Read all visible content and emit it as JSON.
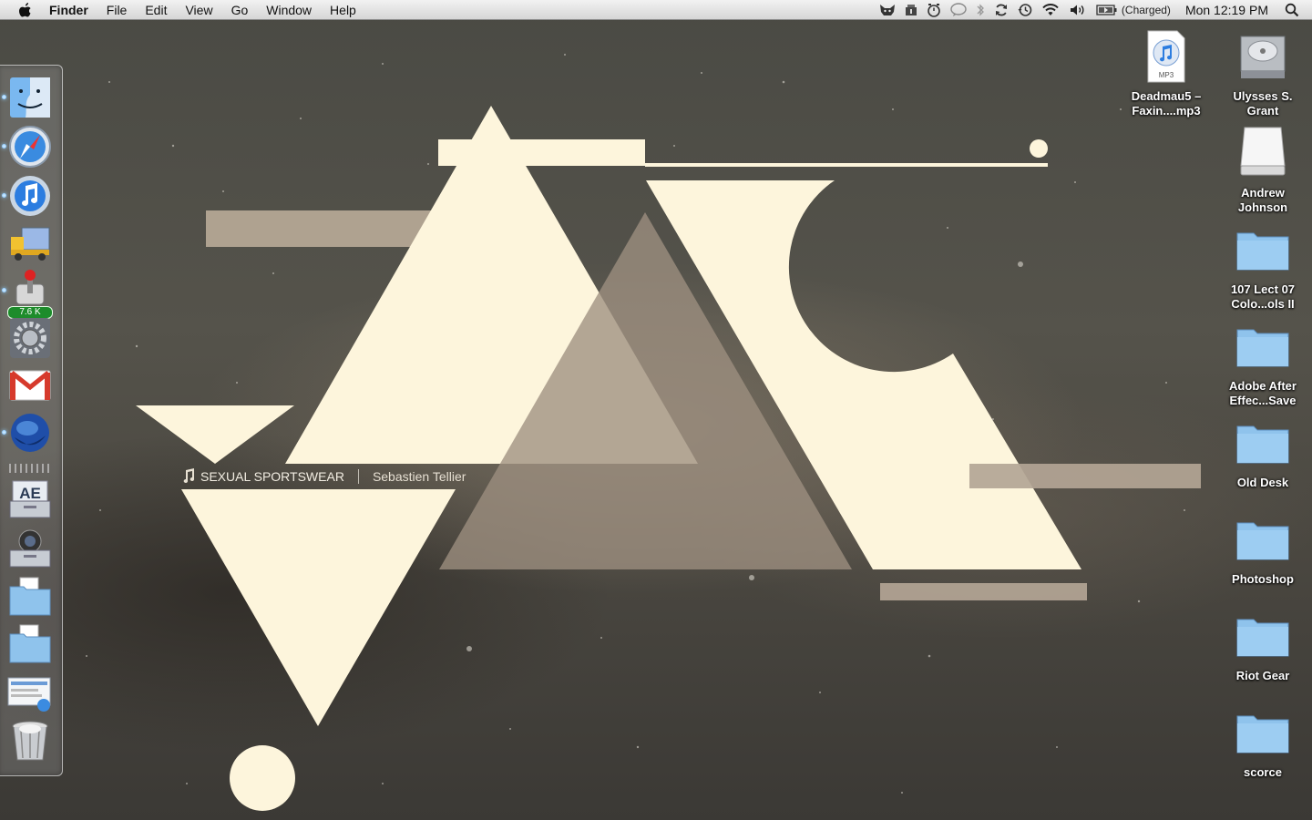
{
  "menubar": {
    "apple_icon": "apple-icon",
    "app_name": "Finder",
    "menus": [
      "File",
      "Edit",
      "View",
      "Go",
      "Window",
      "Help"
    ],
    "status": {
      "battery_text": "(Charged)",
      "clock": "Mon 12:19 PM"
    }
  },
  "now_playing": {
    "track": "SEXUAL SPORTSWEAR",
    "artist": "Sebastien Tellier"
  },
  "dock": {
    "badges": {
      "transmission": "7.6 K"
    },
    "items": [
      "Finder",
      "Safari",
      "iTunes",
      "Transmit",
      "Transmission",
      "System Preferences",
      "Gmail",
      "Firefox",
      "After Effects Folder",
      "Camera Folder",
      "Folder",
      "Folder",
      "Documents Stack",
      "Trash"
    ]
  },
  "desktop_icons": [
    {
      "label_line1": "Deadmau5 –",
      "label_line2": "Faxin....mp3",
      "type": "mp3",
      "file_badge": "MP3"
    },
    {
      "label_line1": "Ulysses S.",
      "label_line2": "Grant",
      "type": "hard-drive"
    },
    {
      "label_line1": "Andrew",
      "label_line2": "Johnson",
      "type": "external-drive"
    },
    {
      "label_line1": "107 Lect 07",
      "label_line2": "Colo...ols II",
      "type": "folder"
    },
    {
      "label_line1": "Adobe After",
      "label_line2": "Effec...Save",
      "type": "folder"
    },
    {
      "label_line1": "Old Desk",
      "label_line2": "",
      "type": "folder"
    },
    {
      "label_line1": "Photoshop",
      "label_line2": "",
      "type": "folder"
    },
    {
      "label_line1": "Riot Gear",
      "label_line2": "",
      "type": "folder"
    },
    {
      "label_line1": "scorce",
      "label_line2": "",
      "type": "folder"
    }
  ],
  "colors": {
    "cream": "#fdf5dc",
    "taupe": "#b3a595",
    "folder_blue": "#8fc3ec"
  }
}
